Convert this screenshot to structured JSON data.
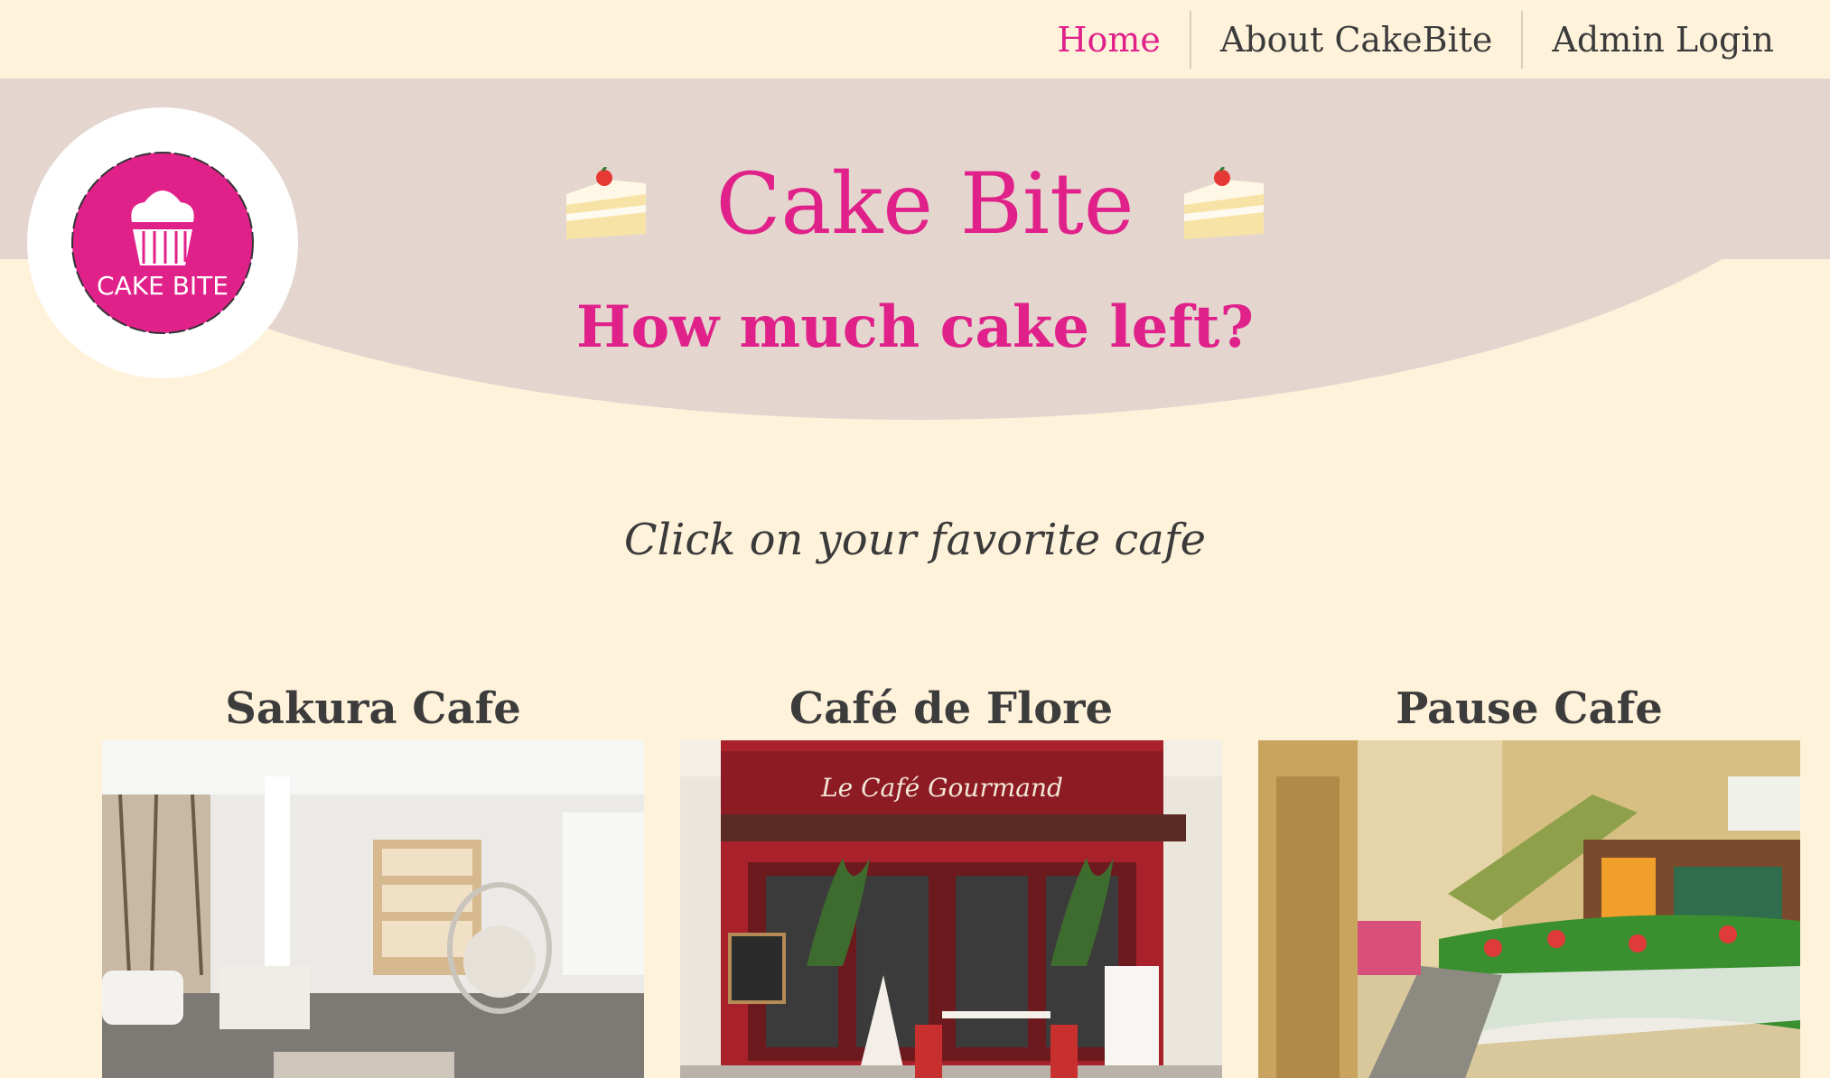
{
  "nav": {
    "items": [
      {
        "label": "Home",
        "active": true
      },
      {
        "label": "About CakeBite",
        "active": false
      },
      {
        "label": "Admin Login",
        "active": false
      }
    ]
  },
  "logo": {
    "text": "CAKE BITE",
    "icon": "cupcake-icon"
  },
  "hero": {
    "title": "Cake Bite",
    "subtitle": "How much cake left?",
    "icon": "cake-slice-icon"
  },
  "instruction": "Click on your favorite cafe",
  "cafes": [
    {
      "name": "Sakura Cafe",
      "image": "sakura-cafe-photo"
    },
    {
      "name": "Café de Flore",
      "image": "cafe-de-flore-photo",
      "sign": "Le Café Gourmand"
    },
    {
      "name": "Pause Cafe",
      "image": "pause-cafe-photo"
    }
  ],
  "colors": {
    "accent": "#e0218a",
    "background": "#fff2db",
    "hero_band": "#e4d6cf",
    "text": "#3a3a3a"
  }
}
